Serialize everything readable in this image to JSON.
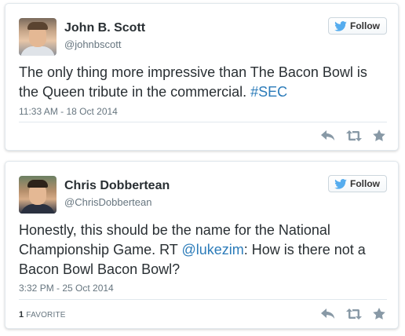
{
  "tweets": [
    {
      "name": "John B. Scott",
      "handle": "@johnbscott",
      "follow_label": "Follow",
      "text_before": "The only thing more impressive than The Bacon Bowl is the Queen tribute in the commercial. ",
      "hashtag": "#SEC",
      "time": "11:33 AM - 18 Oct 2014"
    },
    {
      "name": "Chris Dobbertean",
      "handle": "@ChrisDobbertean",
      "follow_label": "Follow",
      "text_before": "Honestly, this should be the name for the National Championship Game. RT ",
      "mention": "@lukezim",
      "text_after": ": How is there not a Bacon Bowl Bacon Bowl?",
      "time": "3:32 PM - 25 Oct 2014",
      "favorites_count": "1",
      "favorites_label": "FAVORITE"
    }
  ],
  "icons": {
    "follow": "twitter-bird-icon",
    "reply": "reply-icon",
    "retweet": "retweet-icon",
    "favorite": "star-icon"
  },
  "colors": {
    "link": "#2b7bb9",
    "icon": "#8899a6",
    "bird": "#55acee"
  }
}
